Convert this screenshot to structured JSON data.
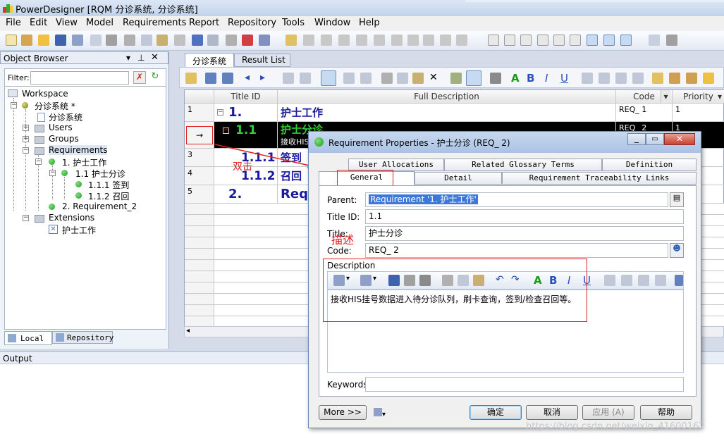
{
  "window": {
    "title": "PowerDesigner [RQM 分诊系统, 分诊系统]"
  },
  "menu": [
    "File",
    "Edit",
    "View",
    "Model",
    "Requirements",
    "Report",
    "Repository",
    "Tools",
    "Window",
    "Help"
  ],
  "object_browser": {
    "title": "Object Browser",
    "filter_label": "Filter:",
    "filter_value": "",
    "tree": [
      "Workspace",
      "分诊系统 *",
      "分诊系统",
      "Users",
      "Groups",
      "Requirements",
      "1. 护士工作",
      "1.1 护士分诊",
      "1.1.1 签到",
      "1.1.2 召回",
      "2. Requirement_2",
      "Extensions",
      "护士工作"
    ],
    "tabs": [
      "Local",
      "Repository"
    ]
  },
  "doc_tabs": [
    "分诊系统",
    "Result List"
  ],
  "grid": {
    "headers": [
      "Title ID",
      "Full Description",
      "Code",
      "Priority"
    ],
    "rows": [
      {
        "num": "1",
        "title_id": "1.",
        "desc": "护士工作",
        "code": "REQ_  1",
        "priority": "1"
      },
      {
        "num": "→",
        "title_id": "1.1",
        "desc": "护士分诊",
        "desc2": "接收HIS",
        "code": "REQ_  2",
        "priority": "1"
      },
      {
        "num": "3",
        "title_id": "1.1.1",
        "desc": "签到",
        "code": "",
        "priority": ""
      },
      {
        "num": "4",
        "title_id": "1.1.2",
        "desc": "召回",
        "code": "",
        "priority": ""
      },
      {
        "num": "5",
        "title_id": "2.",
        "desc": "Req",
        "code": "",
        "priority": ""
      }
    ]
  },
  "annotations": {
    "double_click": "双击",
    "describe": "描述"
  },
  "output_label": "Output",
  "dialog": {
    "title": "Requirement Properties - 护士分诊 (REQ_  2)",
    "tabs_row1": [
      "User Allocations",
      "Related Glossary Terms",
      "Definition"
    ],
    "tabs_row2": [
      "General",
      "Detail",
      "Requirement Traceability Links"
    ],
    "parent_label": "Parent:",
    "parent_value": "Requirement '1. 护士工作'",
    "titleid_label": "Title ID:",
    "titleid_value": "1.1",
    "title_label": "Title:",
    "title_value": "护士分诊",
    "code_label": "Code:",
    "code_value": "REQ_  2",
    "desc_label": "Description",
    "desc_text": "接收HIS挂号数据进入待分诊队列，刷卡查询，签到/检查召回等。",
    "keywords_label": "Keywords:",
    "keywords_value": "",
    "more_btn": "More >>",
    "ok_btn": "确定",
    "cancel_btn": "取消",
    "apply_btn": "应用 (A)",
    "help_btn": "帮助"
  },
  "watermark": "https://blog.csdn.net/weixin_41600162",
  "colors": {
    "accent": "#1a1aa0",
    "green": "#33cc33",
    "red": "#e02020"
  }
}
